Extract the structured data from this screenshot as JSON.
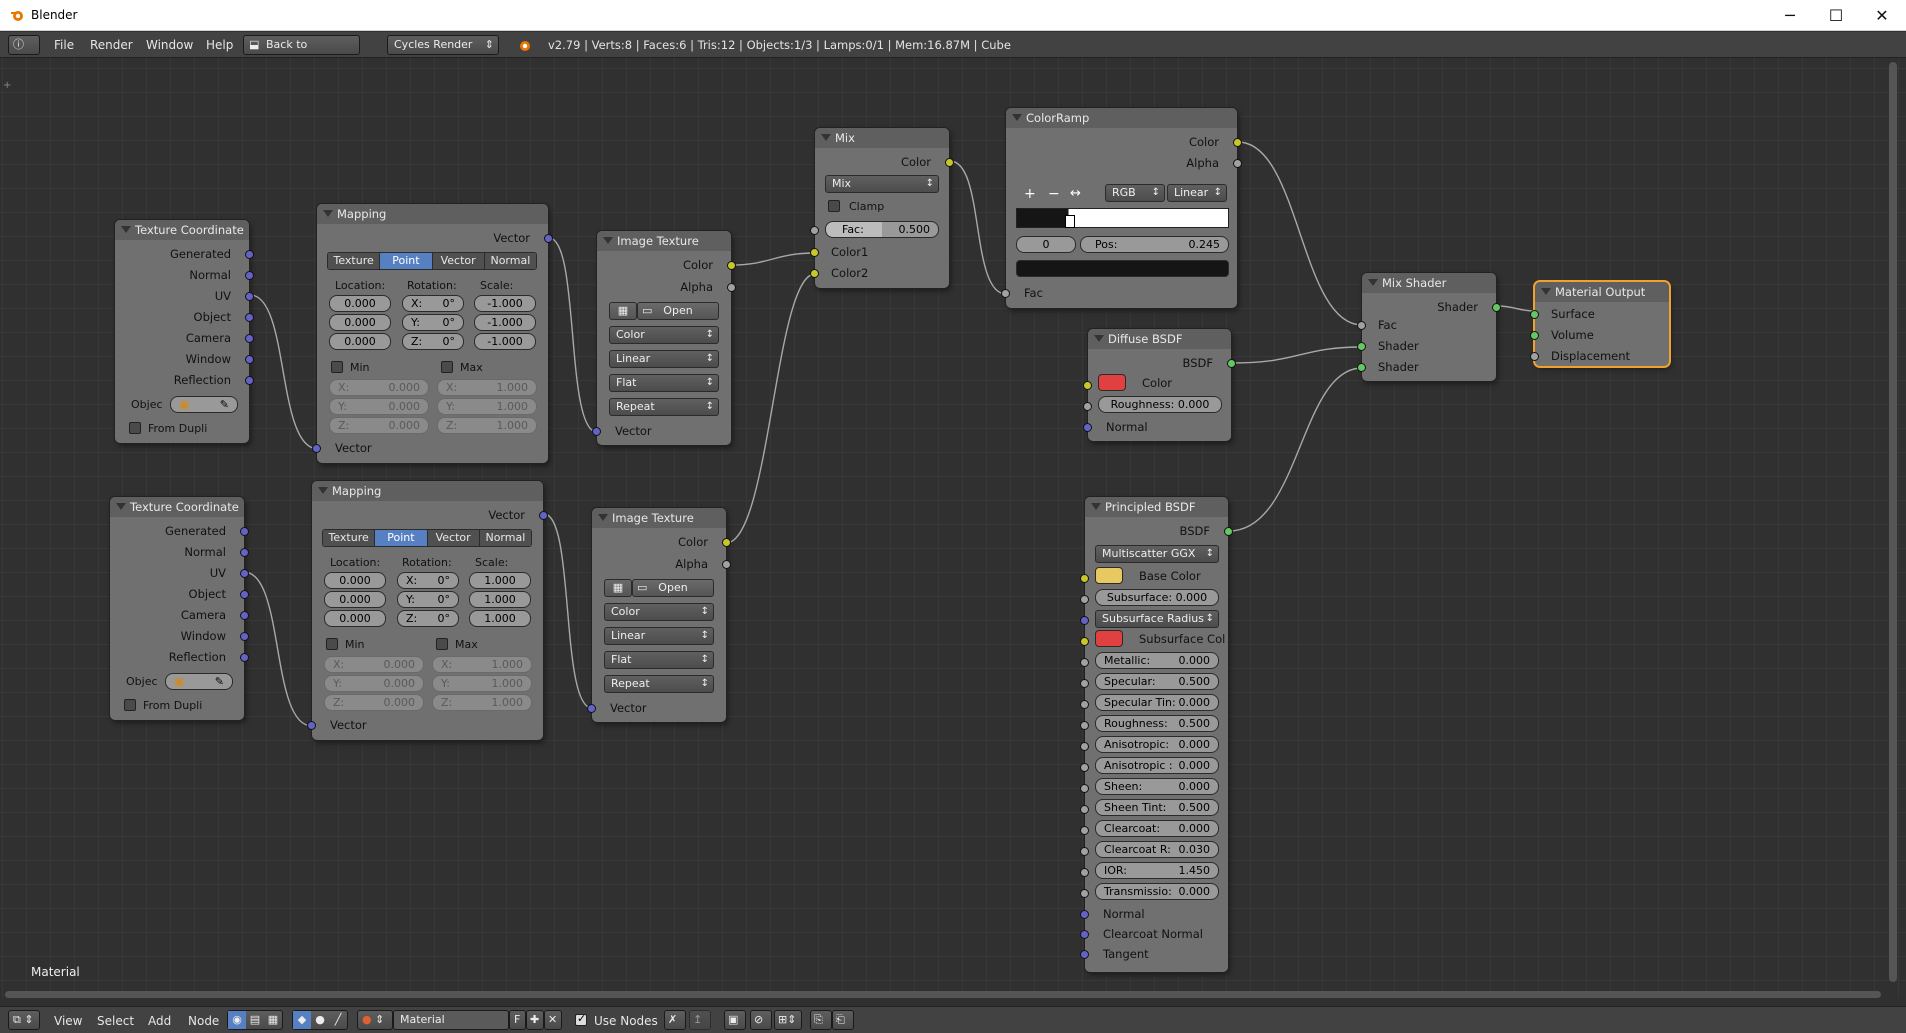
{
  "window": {
    "title": "Blender",
    "minimize": "─",
    "maximize": "☐",
    "close": "✕"
  },
  "topbar": {
    "menus": [
      "File",
      "Render",
      "Window",
      "Help"
    ],
    "back_label": "Back to Previous",
    "engine": "Cycles Render",
    "stats": "v2.79 | Verts:8 | Faces:6 | Tris:12 | Objects:1/3 | Lamps:0/1 | Mem:16.87M | Cube"
  },
  "editor": {
    "label": "Material"
  },
  "bottombar": {
    "menus": [
      "View",
      "Select",
      "Add",
      "Node"
    ],
    "material": "Material",
    "fake_user": "F",
    "use_nodes": "Use Nodes"
  },
  "colors": {
    "wire": "#a8a8a8",
    "socket_color": "#c7c729",
    "socket_shader": "#63c763",
    "socket_vector": "#6363c7",
    "socket_float": "#a1a1a1",
    "red_swatch": "#e04040",
    "yellow_swatch": "#e8c860",
    "select_outline": "#f0a22d"
  },
  "texcoord": {
    "title": "Texture Coordinate",
    "outputs": [
      "Generated",
      "Normal",
      "UV",
      "Object",
      "Camera",
      "Window",
      "Reflection"
    ],
    "object_label": "Objec",
    "from_dupli": "From Dupli"
  },
  "mapping": {
    "title": "Mapping",
    "out": "Vector",
    "in": "Vector",
    "tabs": [
      "Texture",
      "Point",
      "Vector",
      "Normal"
    ],
    "location": "Location:",
    "rotation": "Rotation:",
    "scale": "Scale:",
    "min": "Min",
    "max": "Max",
    "x": "X:",
    "y": "Y:",
    "z": "Z:"
  },
  "mapping1": {
    "loc": [
      "0.000",
      "0.000",
      "0.000"
    ],
    "rot": [
      "0°",
      "0°",
      "0°"
    ],
    "scale": [
      "-1.000",
      "-1.000",
      "-1.000"
    ],
    "minv": [
      "0.000",
      "0.000",
      "0.000"
    ],
    "maxv": [
      "1.000",
      "1.000",
      "1.000"
    ]
  },
  "mapping2": {
    "loc": [
      "0.000",
      "0.000",
      "0.000"
    ],
    "rot": [
      "0°",
      "0°",
      "0°"
    ],
    "scale": [
      "1.000",
      "1.000",
      "1.000"
    ],
    "minv": [
      "0.000",
      "0.000",
      "0.000"
    ],
    "maxv": [
      "1.000",
      "1.000",
      "1.000"
    ]
  },
  "imgtex": {
    "title": "Image Texture",
    "color": "Color",
    "alpha": "Alpha",
    "open": "Open",
    "color_space": "Color",
    "interp": "Linear",
    "proj": "Flat",
    "ext": "Repeat",
    "vector": "Vector"
  },
  "mix": {
    "title": "Mix",
    "color_out": "Color",
    "mode": "Mix",
    "clamp": "Clamp",
    "fac_label": "Fac:",
    "fac": "0.500",
    "color1": "Color1",
    "color2": "Color2"
  },
  "colorramp": {
    "title": "ColorRamp",
    "color": "Color",
    "alpha": "Alpha",
    "plus": "+",
    "minus": "−",
    "flip": "↔",
    "mode": "RGB",
    "interp": "Linear",
    "index": "0",
    "pos_label": "Pos:",
    "pos": "0.245",
    "fac": "Fac"
  },
  "diffuse": {
    "title": "Diffuse BSDF",
    "bsdf": "BSDF",
    "color": "Color",
    "rough_label": "Roughness:",
    "rough": "0.000",
    "normal": "Normal"
  },
  "mixshader": {
    "title": "Mix Shader",
    "shader_out": "Shader",
    "fac": "Fac",
    "shader1": "Shader",
    "shader2": "Shader"
  },
  "output": {
    "title": "Material Output",
    "surface": "Surface",
    "volume": "Volume",
    "displacement": "Displacement"
  },
  "principled": {
    "title": "Principled BSDF",
    "bsdf": "BSDF",
    "distribution": "Multiscatter GGX",
    "base_color": "Base Color",
    "subsurface_radius": "Subsurface Radius",
    "subsurface_col": "Subsurface Col",
    "fields": [
      {
        "l": "Subsurface:",
        "v": "0.000"
      },
      {
        "l": "Metallic:",
        "v": "0.000"
      },
      {
        "l": "Specular:",
        "v": "0.500"
      },
      {
        "l": "Specular Tin:",
        "v": "0.000"
      },
      {
        "l": "Roughness:",
        "v": "0.500"
      },
      {
        "l": "Anisotropic:",
        "v": "0.000"
      },
      {
        "l": "Anisotropic :",
        "v": "0.000"
      },
      {
        "l": "Sheen:",
        "v": "0.000"
      },
      {
        "l": "Sheen Tint:",
        "v": "0.500"
      },
      {
        "l": "Clearcoat:",
        "v": "0.000"
      },
      {
        "l": "Clearcoat R:",
        "v": "0.030"
      },
      {
        "l": "IOR:",
        "v": "1.450"
      },
      {
        "l": "Transmissio:",
        "v": "0.000"
      }
    ],
    "normal": "Normal",
    "clearcoat_normal": "Clearcoat Normal",
    "tangent": "Tangent"
  }
}
